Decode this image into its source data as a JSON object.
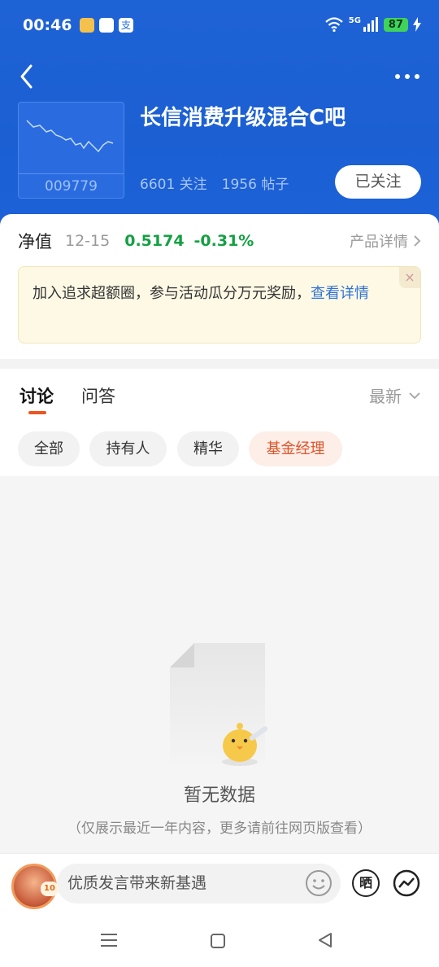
{
  "status_bar": {
    "time": "00:46",
    "network": "5G",
    "battery": "87"
  },
  "header": {
    "fund_title": "长信消费升级混合C吧",
    "fund_code": "009779",
    "followers": "6601 关注",
    "posts": "1956 帖子",
    "follow_button": "已关注"
  },
  "nav": {
    "label": "净值",
    "date": "12-15",
    "value": "0.5174",
    "change": "-0.31%",
    "detail_link": "产品详情",
    "change_color": "#14a043"
  },
  "promo": {
    "text": "加入追求超额圈，参与活动瓜分万元奖励，",
    "link": "查看详情",
    "close": "×"
  },
  "tabs": {
    "discussion": "讨论",
    "qa": "问答",
    "sort": "最新"
  },
  "filters": [
    "全部",
    "持有人",
    "精华",
    "基金经理"
  ],
  "empty_state": {
    "title": "暂无数据",
    "subtitle": "（仅展示最近一年内容，更多请前往网页版查看）"
  },
  "bottom_bar": {
    "input_placeholder": "优质发言带来新基遇",
    "avatar_badge": "10",
    "share_icon_text": "晒"
  },
  "colors": {
    "header_blue": "#1e63d6",
    "accent_orange": "#e9561f",
    "green": "#14a043",
    "link_blue": "#2f72d8"
  },
  "icons": [
    "back-arrow-icon",
    "more-icon",
    "close-icon",
    "chevron-right-icon",
    "chevron-down-icon",
    "emoji-icon",
    "share-icon",
    "chart-icon",
    "menu-icon",
    "home-icon",
    "back-triangle-icon"
  ]
}
